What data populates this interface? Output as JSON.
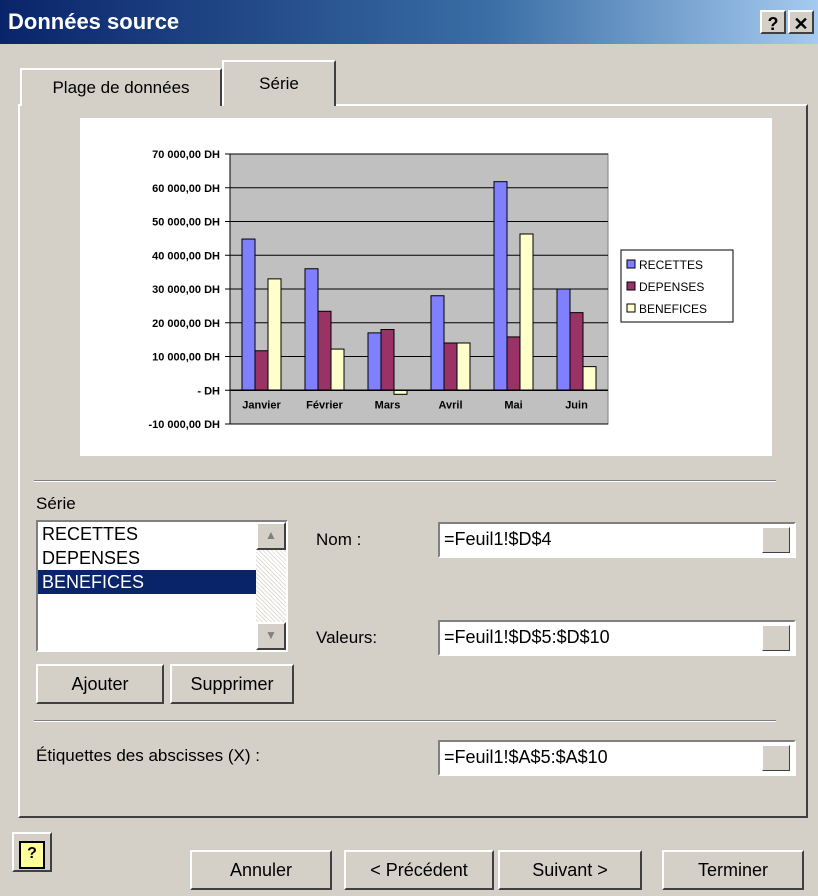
{
  "window": {
    "title": "Données source",
    "help_btn": "?",
    "close_btn": "✕"
  },
  "tabs": [
    {
      "label": "Plage de données"
    },
    {
      "label": "Série"
    }
  ],
  "chart_data": {
    "type": "bar",
    "categories": [
      "Janvier",
      "Février",
      "Mars",
      "Avril",
      "Mai",
      "Juin"
    ],
    "series": [
      {
        "name": "RECETTES",
        "values": [
          44800,
          36000,
          17000,
          28000,
          61800,
          30000
        ],
        "color": "#8080ff"
      },
      {
        "name": "DEPENSES",
        "values": [
          11700,
          23400,
          18000,
          14000,
          15800,
          23000
        ],
        "color": "#993366"
      },
      {
        "name": "BENEFICES",
        "values": [
          33000,
          12200,
          -1200,
          14000,
          46300,
          7000
        ],
        "color": "#ffffcc"
      }
    ],
    "ylim": [
      -10000,
      70000
    ],
    "yticks": [
      "70 000,00 DH",
      "60 000,00 DH",
      "50 000,00 DH",
      "40 000,00 DH",
      "30 000,00 DH",
      "20 000,00 DH",
      "10 000,00 DH",
      "-    DH",
      "-10 000,00 DH"
    ],
    "legend_position": "right",
    "plot_bg": "#c0c0c0",
    "grid": true
  },
  "serie_section": {
    "label": "Série",
    "items": [
      {
        "label": "RECETTES"
      },
      {
        "label": "DEPENSES"
      },
      {
        "label": "BENEFICES",
        "selected": true
      }
    ],
    "nom_label": "Nom :",
    "nom_value": "=Feuil1!$D$4",
    "valeurs_label": "Valeurs:",
    "valeurs_value": "=Feuil1!$D$5:$D$10",
    "add_button": "Ajouter",
    "remove_button": "Supprimer"
  },
  "abscisses": {
    "label": "Étiquettes des abscisses (X) :",
    "value": "=Feuil1!$A$5:$A$10"
  },
  "footer": {
    "help_icon": "?",
    "cancel": "Annuler",
    "previous": "< Précédent",
    "next": "Suivant >",
    "finish": "Terminer"
  }
}
